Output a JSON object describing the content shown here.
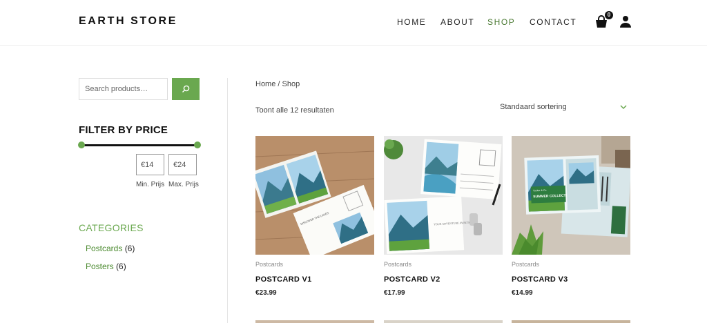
{
  "header": {
    "logo": "EARTH STORE",
    "nav": [
      "HOME",
      "ABOUT",
      "SHOP",
      "CONTACT"
    ],
    "active_nav": "SHOP",
    "cart_count": "0",
    "accent_color": "#6aa84f"
  },
  "sidebar": {
    "search_placeholder": "Search products…",
    "filter_title": "FILTER BY PRICE",
    "min_price": "€14",
    "max_price": "€24",
    "min_label": "Min. Prijs",
    "max_label": "Max. Prijs",
    "categories_title": "CATEGORIES",
    "categories": [
      {
        "name": "Postcards",
        "count": "(6)"
      },
      {
        "name": "Posters",
        "count": "(6)"
      }
    ]
  },
  "main": {
    "breadcrumb": "Home / Shop",
    "results": "Toont alle 12 resultaten",
    "sort_label": "Standaard sortering",
    "products": [
      {
        "category": "Postcards",
        "title": "POSTCARD V1",
        "price": "€23.99"
      },
      {
        "category": "Postcards",
        "title": "POSTCARD V2",
        "price": "€17.99"
      },
      {
        "category": "Postcards",
        "title": "POSTCARD V3",
        "price": "€14.99"
      }
    ],
    "card_texts": {
      "v1_card_text": "DISCOVER THE LAKES",
      "v2_card_text": "YOUR ADVENTURE AWAITS",
      "v3_card_small": "Tucker & Co.",
      "v3_card_big": "SUMMER COLLECTION"
    }
  }
}
